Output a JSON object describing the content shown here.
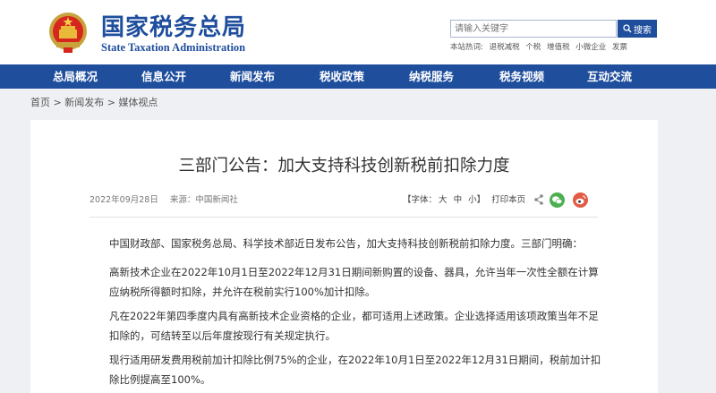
{
  "header": {
    "title": "国家税务总局",
    "subtitle": "State Taxation Administration",
    "search": {
      "placeholder": "请输入关键字",
      "button_label": "搜索"
    },
    "hot_words": {
      "label": "本站热词:",
      "items": [
        "退税减税",
        "个税",
        "增值税",
        "小微企业",
        "发票"
      ]
    }
  },
  "nav": {
    "items": [
      "总局概况",
      "信息公开",
      "新闻发布",
      "税收政策",
      "纳税服务",
      "税务视频",
      "互动交流"
    ]
  },
  "breadcrumb": {
    "items": [
      "首页",
      "新闻发布",
      "媒体视点"
    ],
    "separator": ">"
  },
  "article": {
    "title": "三部门公告：加大支持科技创新税前扣除力度",
    "date": "2022年09月28日",
    "source": "来源：中国新闻社",
    "tools": {
      "font_label": "【字体：",
      "size_large": "大",
      "size_medium": "中",
      "size_small": "小",
      "font_close": "】",
      "print_label": "打印本页"
    },
    "paragraphs": [
      "中国财政部、国家税务总局、科学技术部近日发布公告，加大支持科技创新税前扣除力度。三部门明确：",
      "高新技术企业在2022年10月1日至2022年12月31日期间新购置的设备、器具，允许当年一次性全额在计算应纳税所得额时扣除，并允许在税前实行100%加计扣除。",
      "凡在2022年第四季度内具有高新技术企业资格的企业，都可适用上述政策。企业选择适用该项政策当年不足扣除的，可结转至以后年度按现行有关规定执行。",
      "现行适用研发费用税前加计扣除比例75%的企业，在2022年10月1日至2022年12月31日期间，税前加计扣除比例提高至100%。"
    ]
  },
  "colors": {
    "brand_blue": "#1f4e9d",
    "page_bg": "#eef0f3",
    "wechat_green": "#4caf50",
    "weibo_red": "#e25b45"
  }
}
